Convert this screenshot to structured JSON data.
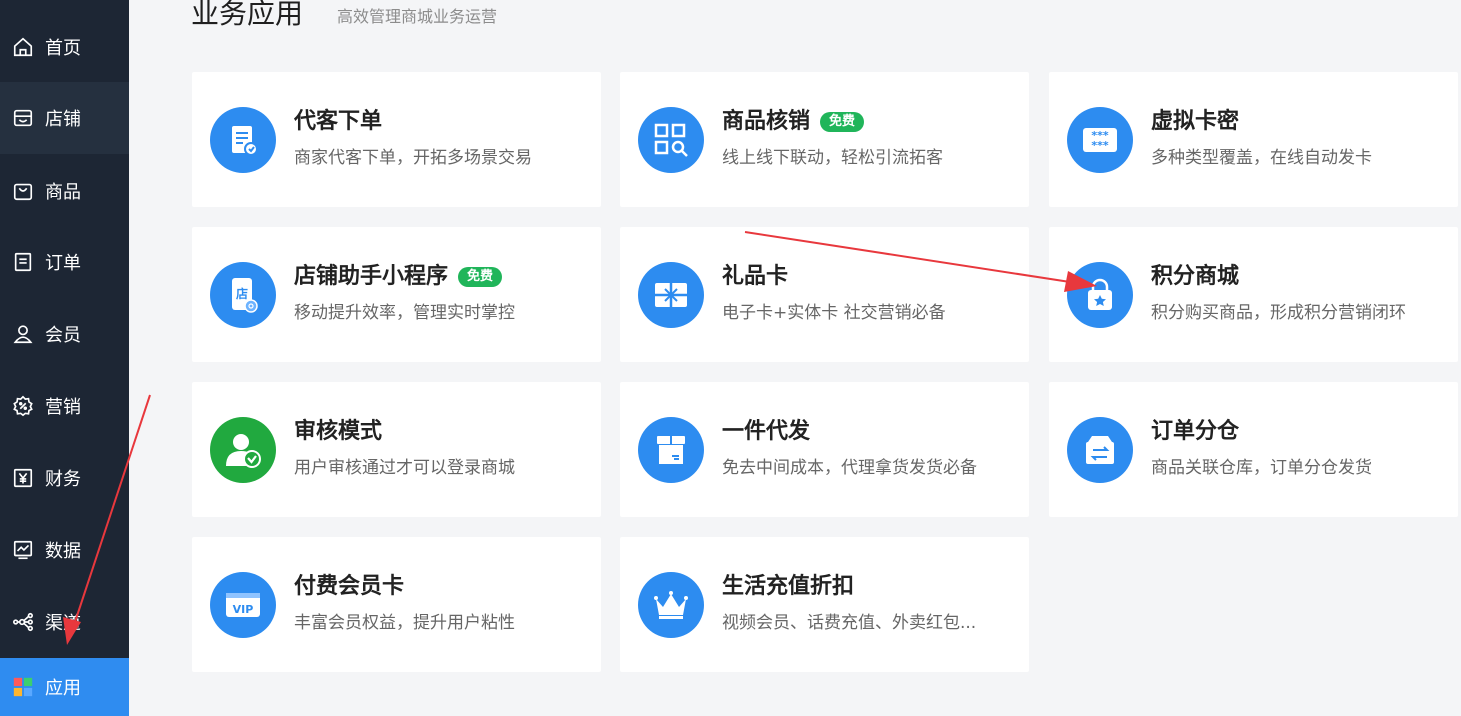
{
  "sidebar": {
    "items": [
      {
        "label": "首页",
        "icon": "home-icon"
      },
      {
        "label": "店铺",
        "icon": "store-icon"
      },
      {
        "label": "商品",
        "icon": "bag-icon"
      },
      {
        "label": "订单",
        "icon": "document-icon"
      },
      {
        "label": "会员",
        "icon": "user-icon"
      },
      {
        "label": "营销",
        "icon": "discount-gear-icon"
      },
      {
        "label": "财务",
        "icon": "yen-icon"
      },
      {
        "label": "数据",
        "icon": "chart-icon"
      },
      {
        "label": "渠道",
        "icon": "channel-icon"
      },
      {
        "label": "应用",
        "icon": "apps-icon"
      }
    ],
    "active_index": 9,
    "hover_index": 1,
    "colors": {
      "bg": "#1d2634",
      "hover": "#25303f",
      "active": "#2f8cf0"
    }
  },
  "header": {
    "title": "业务应用",
    "subtitle": "高效管理商城业务运营"
  },
  "apps": [
    {
      "name": "代客下单",
      "desc": "商家代客下单，开拓多场景交易",
      "badge": "",
      "icon": "order-list-icon",
      "color": "#2d8cf0"
    },
    {
      "name": "商品核销",
      "desc": "线上线下联动，轻松引流拓客",
      "badge": "免费",
      "icon": "qr-scan-icon",
      "color": "#2d8cf0"
    },
    {
      "name": "虚拟卡密",
      "desc": "多种类型覆盖，在线自动发卡",
      "badge": "",
      "icon": "password-card-icon",
      "color": "#2d8cf0"
    },
    {
      "name": "店铺助手小程序",
      "desc": "移动提升效率，管理实时掌控",
      "badge": "免费",
      "icon": "mini-program-icon",
      "color": "#2d8cf0"
    },
    {
      "name": "礼品卡",
      "desc": "电子卡+实体卡 社交营销必备",
      "badge": "",
      "icon": "gift-card-icon",
      "color": "#2d8cf0"
    },
    {
      "name": "积分商城",
      "desc": "积分购买商品，形成积分营销闭环",
      "badge": "",
      "icon": "points-bag-icon",
      "color": "#2d8cf0"
    },
    {
      "name": "审核模式",
      "desc": "用户审核通过才可以登录商城",
      "badge": "",
      "icon": "user-verify-icon",
      "color": "#21a93f"
    },
    {
      "name": "一件代发",
      "desc": "免去中间成本，代理拿货发货必备",
      "badge": "",
      "icon": "package-box-icon",
      "color": "#2d8cf0"
    },
    {
      "name": "订单分仓",
      "desc": "商品关联仓库，订单分仓发货",
      "badge": "",
      "icon": "warehouse-transfer-icon",
      "color": "#2d8cf0"
    },
    {
      "name": "付费会员卡",
      "desc": "丰富会员权益，提升用户粘性",
      "badge": "",
      "icon": "vip-card-icon",
      "color": "#2d8cf0"
    },
    {
      "name": "生活充值折扣",
      "desc": "视频会员、话费充值、外卖红包...",
      "badge": "",
      "icon": "crown-icon",
      "color": "#2d8cf0"
    }
  ],
  "annotation_color": "#e8383d",
  "badge_color": "#20b55a"
}
